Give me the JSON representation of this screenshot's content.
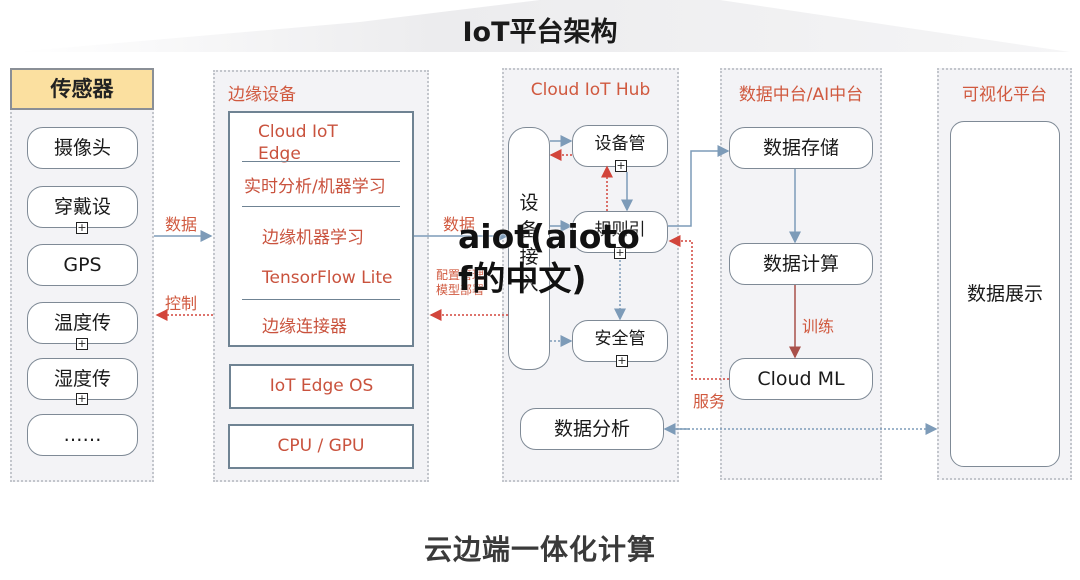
{
  "title": "IoT平台架构",
  "footer": "云边端一体化计算",
  "watermark": "aiot(aiotof的中文)",
  "watermark_lines": [
    "aiot(aioto",
    "f的中文)"
  ],
  "colors": {
    "accent_red": "#d0593f",
    "arrow_blue": "#7d9bb8",
    "header_yellow": "#fbe0a0",
    "column_bg": "#f3f3f6"
  },
  "sensors": {
    "title": "传感器",
    "items": [
      {
        "label": "摄像头",
        "expandable": false
      },
      {
        "label": "穿戴设",
        "expandable": true
      },
      {
        "label": "GPS",
        "expandable": false
      },
      {
        "label": "温度传",
        "expandable": true
      },
      {
        "label": "湿度传",
        "expandable": true
      },
      {
        "label": "……",
        "expandable": false
      }
    ]
  },
  "edge": {
    "title": "边缘设备",
    "cloud_iot_edge": {
      "title_line1": "Cloud IoT",
      "title_line2": "Edge",
      "rows": [
        "实时分析/机器学习",
        "边缘机器学习",
        "TensorFlow Lite",
        "边缘连接器"
      ]
    },
    "os": "IoT Edge OS",
    "hardware": "CPU / GPU"
  },
  "hub": {
    "title": "Cloud IoT Hub",
    "device_access": [
      "设",
      "备",
      "接",
      "入"
    ],
    "device_mgmt": "设备管",
    "rule_engine": "规则引",
    "security_mgmt": "安全管",
    "data_analysis": "数据分析"
  },
  "data_platform": {
    "title": "数据中台/AI中台",
    "storage": "数据存储",
    "compute": "数据计算",
    "ml": "Cloud ML"
  },
  "viz": {
    "title": "可视化平台",
    "display": "数据展示"
  },
  "edge_labels": {
    "sensor_to_edge": "数据",
    "edge_to_sensor": "控制",
    "edge_to_hub": "数据",
    "hub_to_edge_line1": "配置管理",
    "hub_to_edge_line2": "模型部署",
    "train": "训练",
    "service": "服务"
  },
  "expand_glyph": "+"
}
